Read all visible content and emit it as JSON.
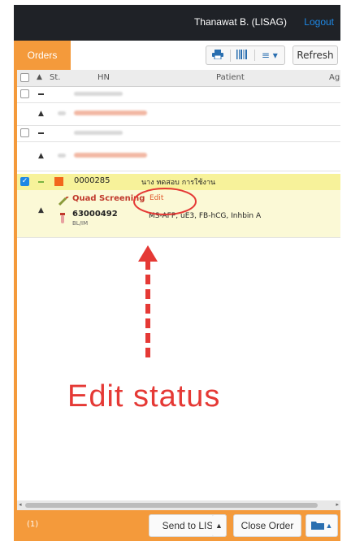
{
  "topbar": {
    "user": "Thanawat B. (LISAG)",
    "logout": "Logout"
  },
  "toolbar": {
    "orders_tab": "Orders",
    "refresh": "Refresh"
  },
  "table": {
    "columns": {
      "st": "St.",
      "hn": "HN",
      "patient": "Patient",
      "age": "Ag"
    }
  },
  "selected_row": {
    "hn": "0000285",
    "patient": "นาง ทดสอบ การใช้งาน"
  },
  "detail": {
    "test_name": "Quad Screening",
    "edit": "Edit",
    "specimen_no": "63000492",
    "specimen_type": "BL/IM",
    "tests": "MS-AFP, uE3, FB-hCG, Inhbin A"
  },
  "annotation": {
    "text": "Edit status"
  },
  "footer": {
    "count": "(1)",
    "send": "Send to LIS",
    "close": "Close Order"
  },
  "colors": {
    "accent": "#f49a3b",
    "topbar": "#1f2227",
    "link": "#1e88e5",
    "annotation": "#e53935"
  }
}
